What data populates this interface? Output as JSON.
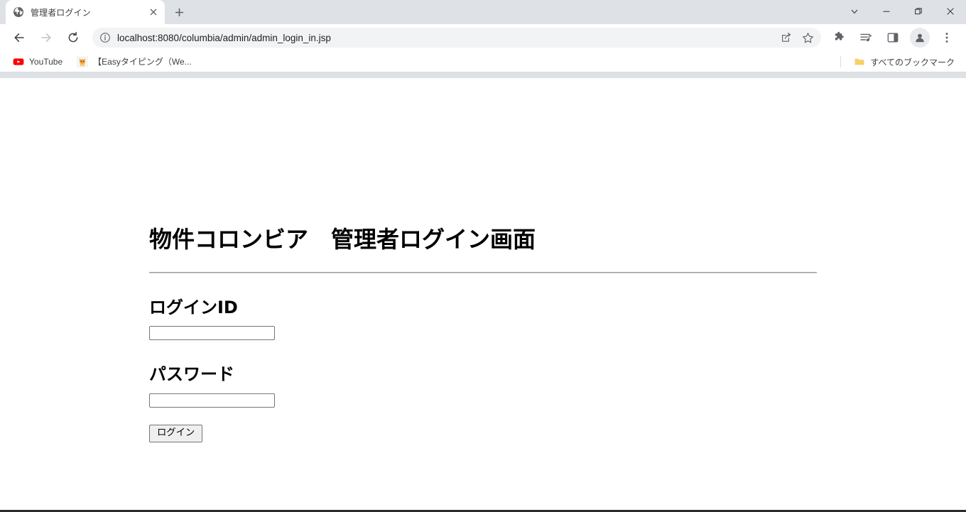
{
  "window": {
    "controls": {
      "tab_search": "tab-search-chevron",
      "minimize": "minimize",
      "maximize": "maximize",
      "close": "close"
    }
  },
  "tabstrip": {
    "tabs": [
      {
        "title": "管理者ログイン",
        "favicon": "globe-icon",
        "active": true,
        "close_label": "×"
      }
    ],
    "new_tab_label": "+"
  },
  "toolbar": {
    "back_label": "←",
    "forward_label": "→",
    "reload_label": "⟳",
    "site_info_icon": "info-circle-icon",
    "url": "localhost:8080/columbia/admin/admin_login_in.jsp",
    "url_host": "localhost:8080",
    "url_path": "/columbia/admin/admin_login_in.jsp",
    "share_icon": "share-icon",
    "bookmark_icon": "star-icon",
    "extensions_icon": "puzzle-icon",
    "reading_list_icon": "media-list-icon",
    "side_panel_icon": "side-panel-icon",
    "profile_icon": "person-avatar-icon",
    "menu_icon": "three-dot-menu-icon"
  },
  "bookmarks": {
    "items": [
      {
        "label": "YouTube",
        "icon": "youtube-icon"
      },
      {
        "label": "【Easyタイピング（We...",
        "icon": "cat-favicon-icon"
      }
    ],
    "all_bookmarks": {
      "label": "すべてのブックマーク",
      "icon": "folder-icon"
    }
  },
  "page": {
    "heading": "物件コロンビア　管理者ログイン画面",
    "fields": [
      {
        "label": "ログインID",
        "value": "",
        "placeholder": "",
        "type": "text"
      },
      {
        "label": "パスワード",
        "value": "",
        "placeholder": "",
        "type": "password"
      }
    ],
    "submit_label": "ログイン"
  },
  "colors": {
    "tabstrip_bg": "#dee1e6",
    "toolbar_bg": "#ffffff",
    "omnibox_bg": "#f1f3f4",
    "text": "#202124",
    "page_bg": "#ffffff",
    "youtube_red": "#ff0000",
    "folder_yellow": "#f7d067"
  }
}
